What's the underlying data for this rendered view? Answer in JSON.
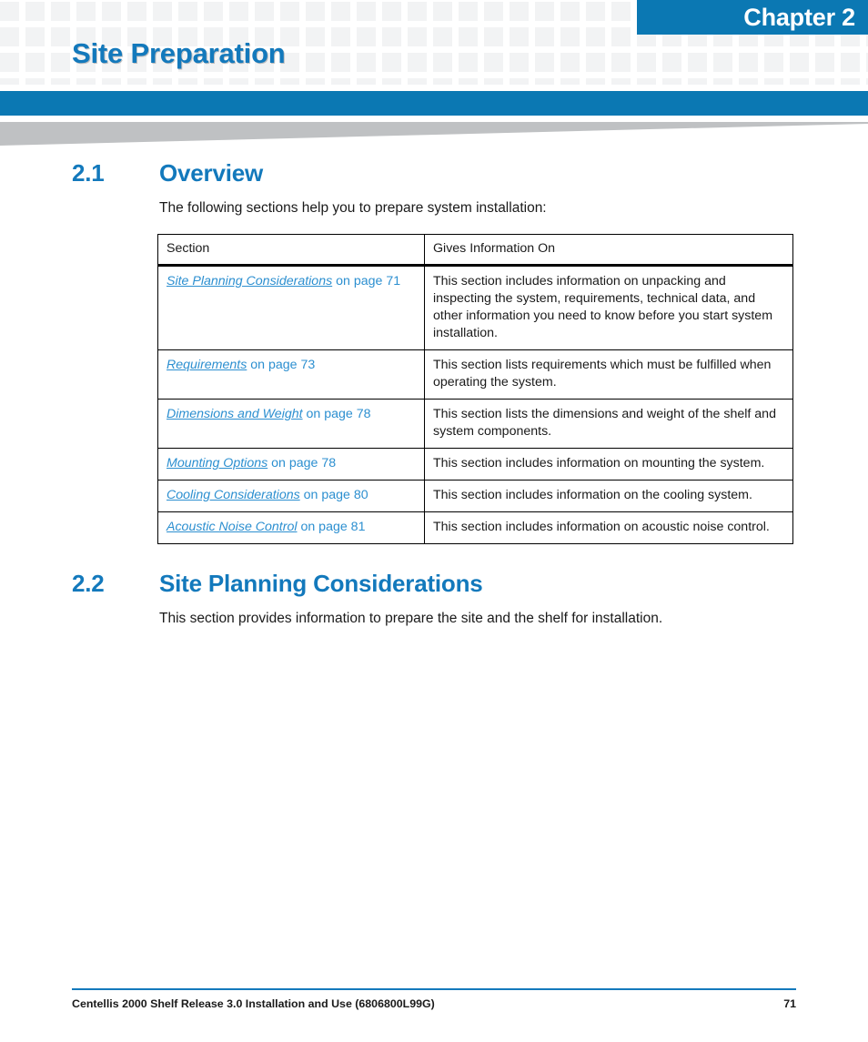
{
  "header": {
    "chapter_label": "Chapter 2",
    "chapter_title": "Site Preparation",
    "accent_blue": "#0b78b3",
    "heading_blue": "#1379bc",
    "link_blue": "#2c8fd0",
    "grid_gray": "#f2f3f4",
    "wedge_gray": "#bfc1c3"
  },
  "sections": [
    {
      "number": "2.1",
      "title": "Overview",
      "intro": "The following sections help you to prepare system installation:"
    },
    {
      "number": "2.2",
      "title": "Site Planning Considerations",
      "intro": "This section provides information to prepare the site and the shelf for installation."
    }
  ],
  "table": {
    "headers": [
      "Section",
      "Gives Information On"
    ],
    "rows": [
      {
        "link_text": "Site Planning Considerations",
        "link_tail": " on page 71",
        "description": "This section includes information on unpacking and inspecting the system, requirements, technical data, and other information you need to know before you start system installation."
      },
      {
        "link_text": "Requirements",
        "link_tail": " on page 73",
        "description": "This section lists requirements which must be fulfilled when operating the system."
      },
      {
        "link_text": "Dimensions and Weight",
        "link_tail": " on page 78",
        "description": "This section lists the dimensions and weight of the shelf and system components."
      },
      {
        "link_text": "Mounting Options",
        "link_tail": " on page 78",
        "description": "This section includes information on mounting the system."
      },
      {
        "link_text": "Cooling Considerations",
        "link_tail": " on page 80",
        "description": "This section includes information on the cooling system."
      },
      {
        "link_text": "Acoustic Noise Control",
        "link_tail": " on page 81",
        "description": "This section includes information on acoustic noise control."
      }
    ]
  },
  "footer": {
    "document_title": "Centellis 2000 Shelf Release 3.0 Installation and Use (6806800L99G)",
    "page_number": "71"
  }
}
